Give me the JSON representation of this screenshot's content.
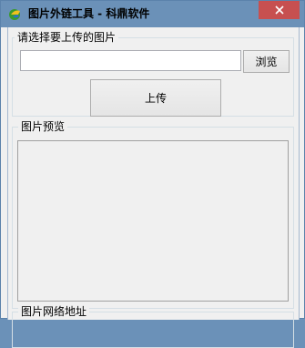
{
  "window": {
    "title": "图片外链工具 - 科鼎软件",
    "app_icon": "app-icon",
    "close_icon": "close-icon"
  },
  "upload_group": {
    "legend": "请选择要上传的图片",
    "file_path_value": "",
    "browse_label": "浏览",
    "upload_label": "上传"
  },
  "preview_group": {
    "legend": "图片预览"
  },
  "link_group": {
    "legend": "图片网络地址"
  },
  "colors": {
    "titlebar": "#6b91b8",
    "close_button": "#c75050",
    "window_bg": "#f0f0f0"
  }
}
